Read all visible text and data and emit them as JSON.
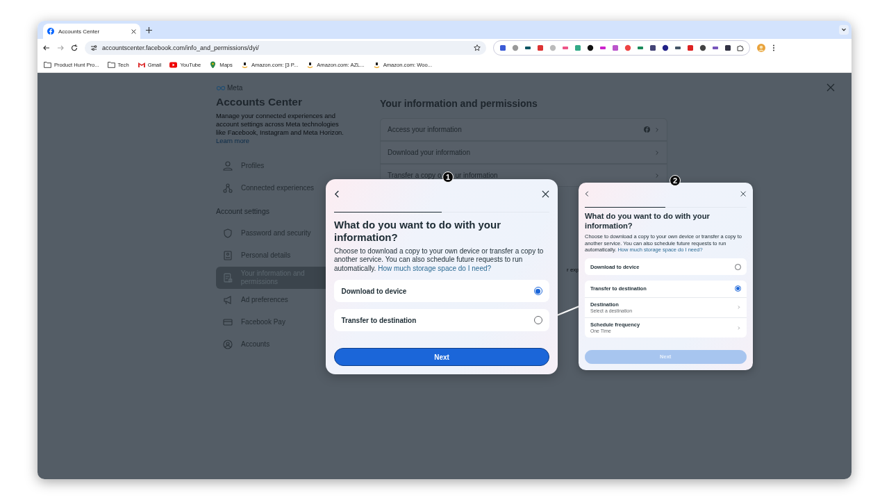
{
  "browser": {
    "tabs": [
      {
        "title": "Accounts Center",
        "selected": true
      }
    ],
    "url": "accountscenter.facebook.com/info_and_permissions/dyi/",
    "bookmarks": [
      {
        "label": "Product Hunt Pro...",
        "kind": "folder"
      },
      {
        "label": "Tech",
        "kind": "folder"
      },
      {
        "label": "Gmail",
        "kind": "site"
      },
      {
        "label": "YouTube",
        "kind": "site"
      },
      {
        "label": "Maps",
        "kind": "site"
      },
      {
        "label": "Amazon.com: [3 P...",
        "kind": "site"
      },
      {
        "label": "Amazon.com: AZL...",
        "kind": "site"
      },
      {
        "label": "Amazon.com: Woo...",
        "kind": "site"
      }
    ]
  },
  "page": {
    "brand": "Meta",
    "title": "Accounts Center",
    "description": "Manage your connected experiences and account settings across Meta technologies like Facebook, Instagram and Meta Horizon.",
    "learn_more": "Learn more",
    "nav": [
      {
        "label": "Profiles",
        "selected": false
      },
      {
        "label": "Connected experiences",
        "selected": false
      }
    ],
    "settings_heading": "Account settings",
    "settings_nav": [
      {
        "label": "Password and security",
        "selected": false
      },
      {
        "label": "Personal details",
        "selected": false
      },
      {
        "label": "Your information and permissions",
        "selected": true
      },
      {
        "label": "Ad preferences",
        "selected": false
      },
      {
        "label": "Facebook Pay",
        "selected": false
      },
      {
        "label": "Accounts",
        "selected": false
      }
    ],
    "main_title": "Your information and permissions",
    "rows": [
      {
        "label": "Access your information",
        "label_after": ""
      },
      {
        "label": "Download your information",
        "label_after": ""
      },
      {
        "label": "Transfer a copy o",
        "label_after": "ur information"
      }
    ],
    "fragment": "r exp"
  },
  "dialogs": [
    {
      "badge": "1",
      "progress": {
        "level": 0.5
      },
      "title": "What do you want to do with your information?",
      "description": "Choose to download a copy to your own device or transfer a copy to another service. You can also schedule future requests to run automatically.",
      "link": "How much storage space do I need?",
      "options": [
        {
          "kind": "option",
          "label": "Download to device",
          "selected": true
        },
        {
          "kind": "option",
          "label": "Transfer to destination",
          "selected": false
        }
      ],
      "next": {
        "label": "Next",
        "disabled": false
      }
    },
    {
      "badge": "2",
      "progress": {
        "level": 0.5
      },
      "title": "What do you want to do with your information?",
      "description": "Choose to download a copy to your own device or transfer a copy to another service. You can also schedule future requests to run automatically.",
      "link": "How much storage space do I need?",
      "options": [
        {
          "kind": "option",
          "label": "Download to device",
          "selected": false
        },
        {
          "kind": "option",
          "label": "Transfer to destination",
          "selected": true
        },
        {
          "kind": "setting",
          "label": "Destination",
          "value": "Select a destination"
        },
        {
          "kind": "setting",
          "label": "Schedule frequency",
          "value": "One Time"
        }
      ],
      "next": {
        "label": "Next",
        "disabled": true
      }
    }
  ]
}
